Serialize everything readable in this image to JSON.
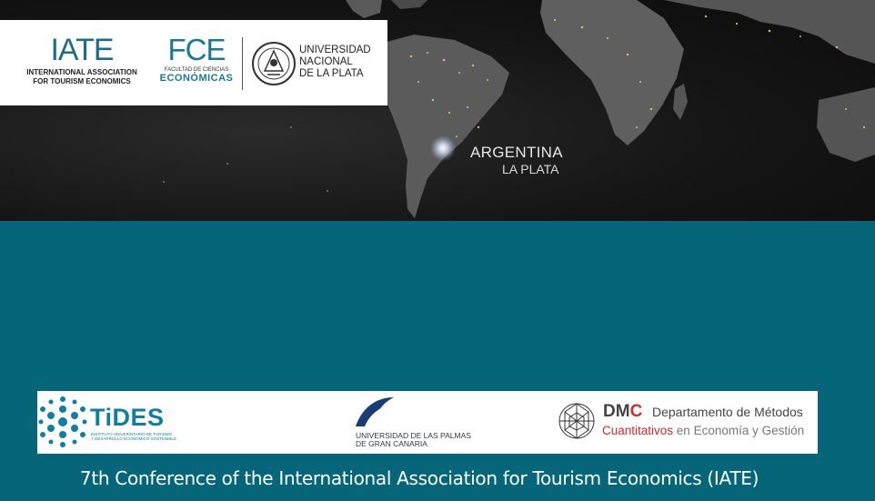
{
  "header_logos": {
    "iate": {
      "mark": "IATE",
      "line1": "INTERNATIONAL ASSOCIATION",
      "line2": "FOR TOURISM ECONOMICS"
    },
    "fce": {
      "mark": "FCE",
      "line1": "FACULTAD DE CIENCIAS",
      "line2": "ECONÓMICAS"
    },
    "unlp": {
      "line1": "UNIVERSIDAD",
      "line2": "NACIONAL",
      "line3": "DE LA PLATA"
    }
  },
  "map": {
    "country": "ARGENTINA",
    "city": "LA PLATA"
  },
  "sponsors": {
    "tides": {
      "name": "TiDES",
      "sub1": "INSTITUTO UNIVERSITARIO DE TURISMO",
      "sub2": "Y DESARROLLO ECONÓMICO SOSTENIBLE"
    },
    "ulpgc": {
      "line1": "UNIVERSIDAD DE LAS PALMAS",
      "line2": "DE GRAN CANARIA"
    },
    "dmc": {
      "letters_dm": "DM",
      "letters_c": "C",
      "line1": "Departamento de Métodos",
      "line2_red": "Cuantitativos",
      "line2_rest": " en Economía y Gestión"
    }
  },
  "footer": {
    "title": "7th Conference of the International Association for Tourism Economics (IATE)"
  },
  "colors": {
    "teal_background": "#05667a",
    "brand_blue": "#18789a",
    "accent_red": "#d42a2a"
  }
}
